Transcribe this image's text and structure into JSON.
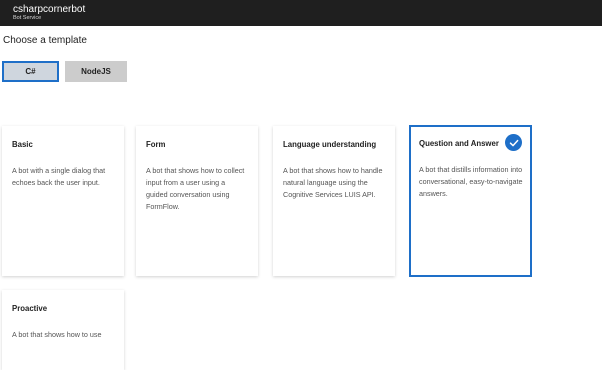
{
  "header": {
    "title": "csharpcornerbot",
    "subtitle": "Bot Service"
  },
  "main": {
    "section_title": "Choose a template",
    "languages": [
      {
        "label": "C#",
        "selected": true
      },
      {
        "label": "NodeJS",
        "selected": false
      }
    ],
    "templates": [
      {
        "title": "Basic",
        "description": "A bot with a single dialog that echoes back the user input.",
        "selected": false
      },
      {
        "title": "Form",
        "description": "A bot that shows how to collect input from a user using a guided conversation using FormFlow.",
        "selected": false
      },
      {
        "title": "Language understanding",
        "description": "A bot that shows how to handle natural language using the Cognitive Services LUIS API.",
        "selected": false
      },
      {
        "title": "Question and Answer",
        "description": "A bot that distills information into conversational, easy-to-navigate answers.",
        "selected": true
      },
      {
        "title": "Proactive",
        "description": "A bot that shows how to use",
        "selected": false
      }
    ]
  },
  "colors": {
    "accent": "#1e6fc8",
    "header_bg": "#1f1f1f"
  },
  "icons": {
    "selected_check": "checkmark-icon"
  }
}
